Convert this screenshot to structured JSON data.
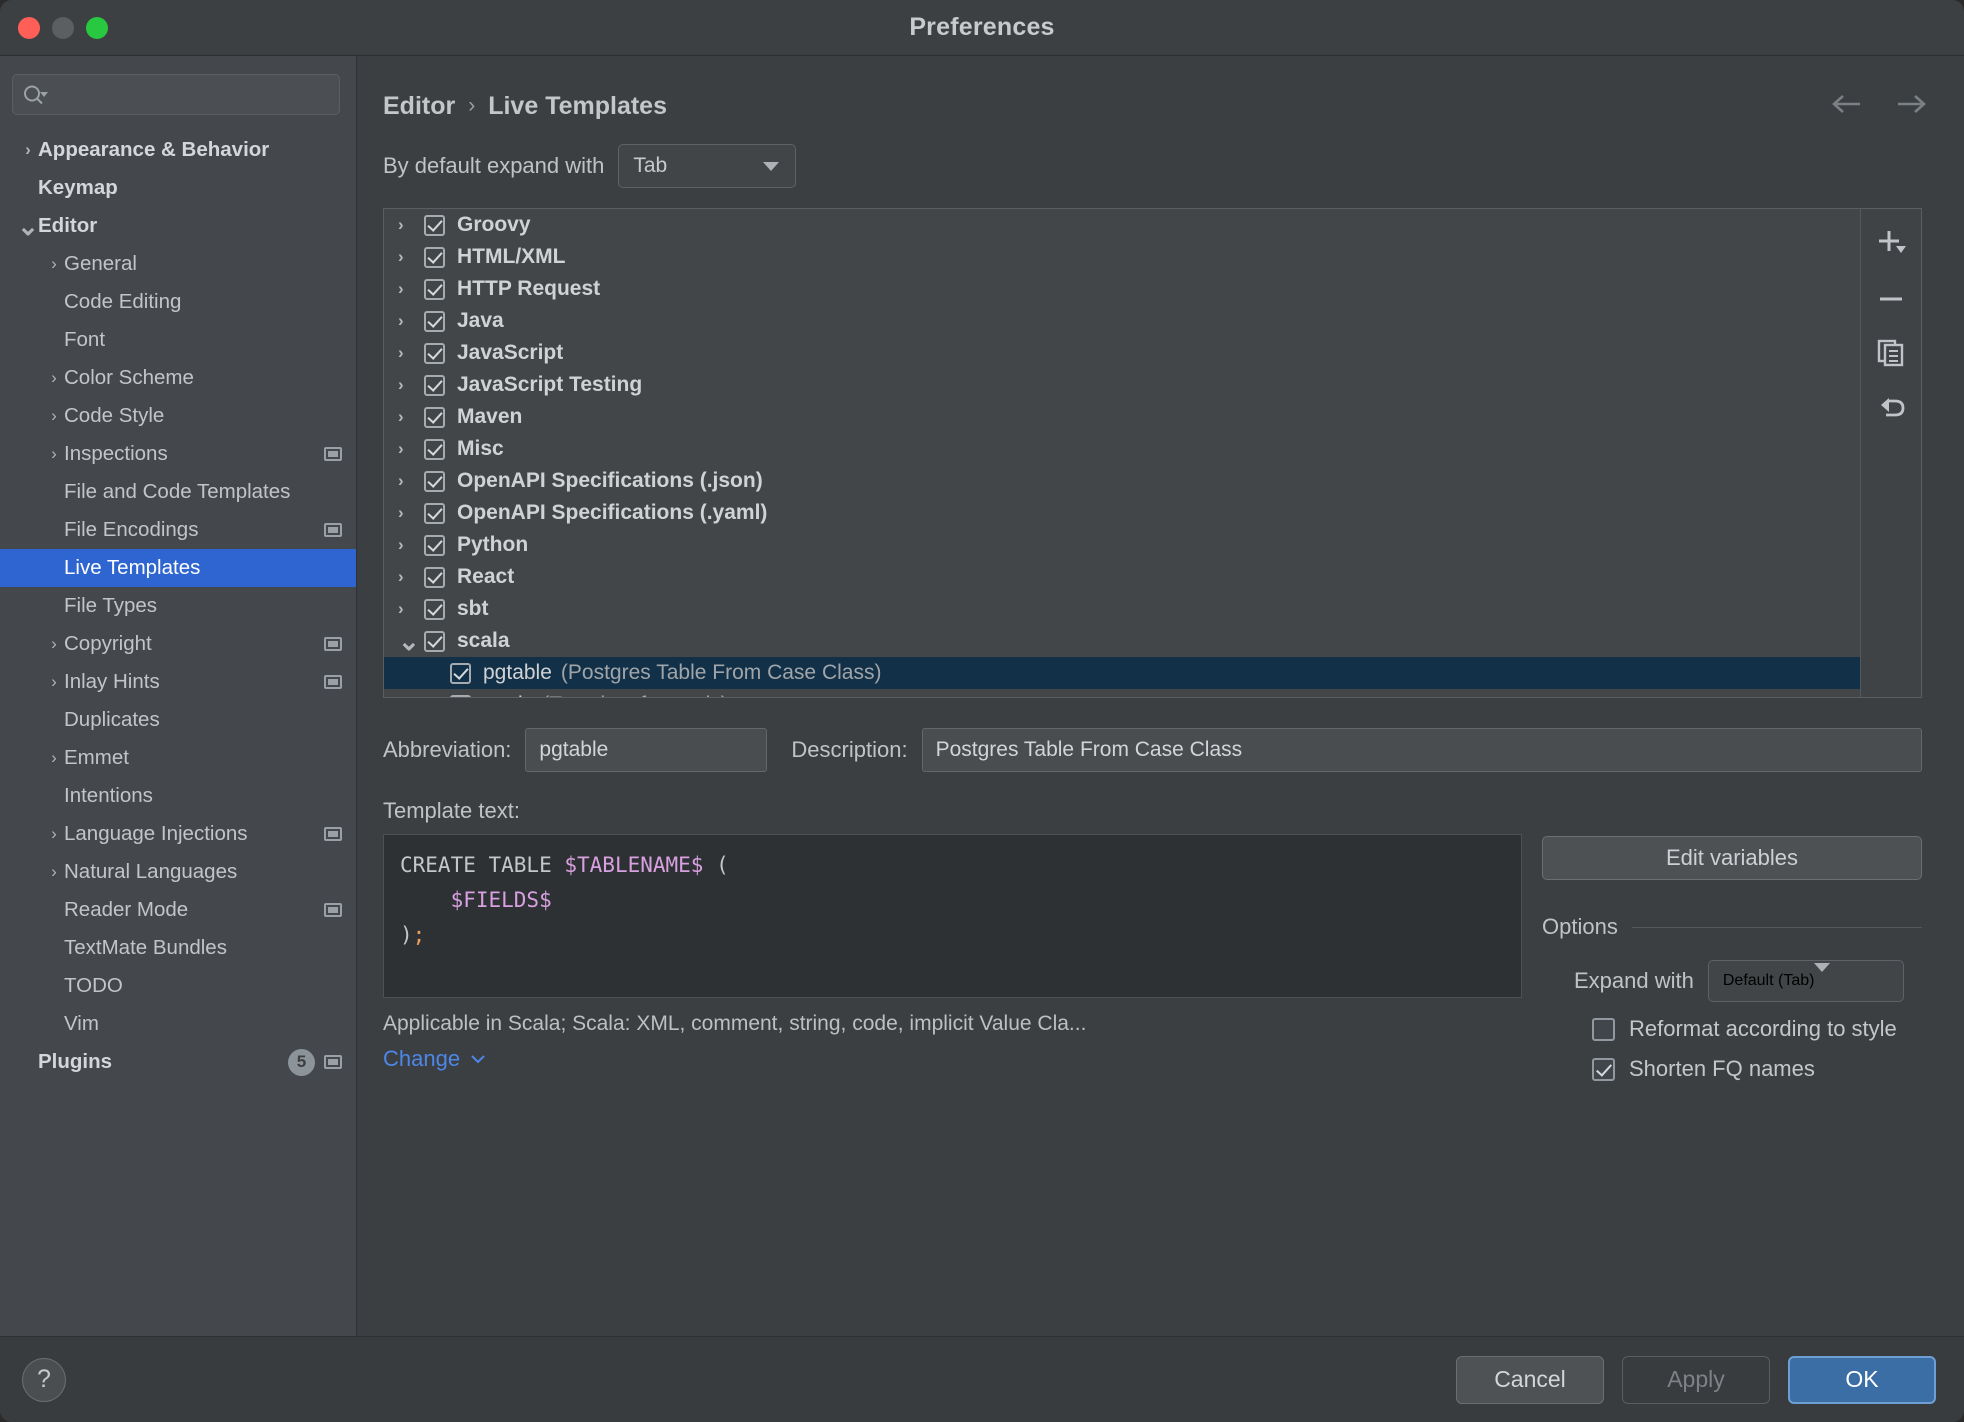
{
  "window": {
    "title": "Preferences"
  },
  "traffic_lights": {
    "close": "close",
    "minimize": "minimize",
    "zoom": "zoom"
  },
  "search": {
    "placeholder": "",
    "value": "",
    "icon": "search-icon"
  },
  "sidebar": {
    "items": [
      {
        "label": "Appearance & Behavior",
        "level": 0,
        "arrow": "right",
        "bold": true,
        "badge": null,
        "modified": false,
        "selected": false
      },
      {
        "label": "Keymap",
        "level": 0,
        "arrow": "none",
        "bold": true,
        "badge": null,
        "modified": false,
        "selected": false
      },
      {
        "label": "Editor",
        "level": 0,
        "arrow": "down",
        "bold": true,
        "badge": null,
        "modified": false,
        "selected": false
      },
      {
        "label": "General",
        "level": 1,
        "arrow": "right",
        "bold": false,
        "badge": null,
        "modified": false,
        "selected": false
      },
      {
        "label": "Code Editing",
        "level": 1,
        "arrow": "none",
        "bold": false,
        "badge": null,
        "modified": false,
        "selected": false
      },
      {
        "label": "Font",
        "level": 1,
        "arrow": "none",
        "bold": false,
        "badge": null,
        "modified": false,
        "selected": false
      },
      {
        "label": "Color Scheme",
        "level": 1,
        "arrow": "right",
        "bold": false,
        "badge": null,
        "modified": false,
        "selected": false
      },
      {
        "label": "Code Style",
        "level": 1,
        "arrow": "right",
        "bold": false,
        "badge": null,
        "modified": false,
        "selected": false
      },
      {
        "label": "Inspections",
        "level": 1,
        "arrow": "right",
        "bold": false,
        "badge": null,
        "modified": true,
        "selected": false
      },
      {
        "label": "File and Code Templates",
        "level": 1,
        "arrow": "none",
        "bold": false,
        "badge": null,
        "modified": false,
        "selected": false
      },
      {
        "label": "File Encodings",
        "level": 1,
        "arrow": "none",
        "bold": false,
        "badge": null,
        "modified": true,
        "selected": false
      },
      {
        "label": "Live Templates",
        "level": 1,
        "arrow": "none",
        "bold": false,
        "badge": null,
        "modified": false,
        "selected": true
      },
      {
        "label": "File Types",
        "level": 1,
        "arrow": "none",
        "bold": false,
        "badge": null,
        "modified": false,
        "selected": false
      },
      {
        "label": "Copyright",
        "level": 1,
        "arrow": "right",
        "bold": false,
        "badge": null,
        "modified": true,
        "selected": false
      },
      {
        "label": "Inlay Hints",
        "level": 1,
        "arrow": "right",
        "bold": false,
        "badge": null,
        "modified": true,
        "selected": false
      },
      {
        "label": "Duplicates",
        "level": 1,
        "arrow": "none",
        "bold": false,
        "badge": null,
        "modified": false,
        "selected": false
      },
      {
        "label": "Emmet",
        "level": 1,
        "arrow": "right",
        "bold": false,
        "badge": null,
        "modified": false,
        "selected": false
      },
      {
        "label": "Intentions",
        "level": 1,
        "arrow": "none",
        "bold": false,
        "badge": null,
        "modified": false,
        "selected": false
      },
      {
        "label": "Language Injections",
        "level": 1,
        "arrow": "right",
        "bold": false,
        "badge": null,
        "modified": true,
        "selected": false
      },
      {
        "label": "Natural Languages",
        "level": 1,
        "arrow": "right",
        "bold": false,
        "badge": null,
        "modified": false,
        "selected": false
      },
      {
        "label": "Reader Mode",
        "level": 1,
        "arrow": "none",
        "bold": false,
        "badge": null,
        "modified": true,
        "selected": false
      },
      {
        "label": "TextMate Bundles",
        "level": 1,
        "arrow": "none",
        "bold": false,
        "badge": null,
        "modified": false,
        "selected": false
      },
      {
        "label": "TODO",
        "level": 1,
        "arrow": "none",
        "bold": false,
        "badge": null,
        "modified": false,
        "selected": false
      },
      {
        "label": "Vim",
        "level": 1,
        "arrow": "none",
        "bold": false,
        "badge": null,
        "modified": false,
        "selected": false
      },
      {
        "label": "Plugins",
        "level": 0,
        "arrow": "none",
        "bold": true,
        "badge": "5",
        "modified": true,
        "selected": false
      }
    ]
  },
  "breadcrumb": {
    "parent": "Editor",
    "separator": "›",
    "current": "Live Templates"
  },
  "nav": {
    "back": "back-arrow",
    "forward": "forward-arrow"
  },
  "expand_with": {
    "label": "By default expand with",
    "value": "Tab"
  },
  "template_tree": {
    "rows": [
      {
        "label": "Groovy",
        "desc": "",
        "level": 0,
        "arrow": "right",
        "checked": true,
        "selected": false
      },
      {
        "label": "HTML/XML",
        "desc": "",
        "level": 0,
        "arrow": "right",
        "checked": true,
        "selected": false
      },
      {
        "label": "HTTP Request",
        "desc": "",
        "level": 0,
        "arrow": "right",
        "checked": true,
        "selected": false
      },
      {
        "label": "Java",
        "desc": "",
        "level": 0,
        "arrow": "right",
        "checked": true,
        "selected": false
      },
      {
        "label": "JavaScript",
        "desc": "",
        "level": 0,
        "arrow": "right",
        "checked": true,
        "selected": false
      },
      {
        "label": "JavaScript Testing",
        "desc": "",
        "level": 0,
        "arrow": "right",
        "checked": true,
        "selected": false
      },
      {
        "label": "Maven",
        "desc": "",
        "level": 0,
        "arrow": "right",
        "checked": true,
        "selected": false
      },
      {
        "label": "Misc",
        "desc": "",
        "level": 0,
        "arrow": "right",
        "checked": true,
        "selected": false
      },
      {
        "label": "OpenAPI Specifications (.json)",
        "desc": "",
        "level": 0,
        "arrow": "right",
        "checked": true,
        "selected": false
      },
      {
        "label": "OpenAPI Specifications (.yaml)",
        "desc": "",
        "level": 0,
        "arrow": "right",
        "checked": true,
        "selected": false
      },
      {
        "label": "Python",
        "desc": "",
        "level": 0,
        "arrow": "right",
        "checked": true,
        "selected": false
      },
      {
        "label": "React",
        "desc": "",
        "level": 0,
        "arrow": "right",
        "checked": true,
        "selected": false
      },
      {
        "label": "sbt",
        "desc": "",
        "level": 0,
        "arrow": "right",
        "checked": true,
        "selected": false
      },
      {
        "label": "scala",
        "desc": "",
        "level": 0,
        "arrow": "down",
        "checked": true,
        "selected": false
      },
      {
        "label": "pgtable",
        "desc": "(Postgres Table From Case Class)",
        "level": 1,
        "arrow": "none",
        "checked": true,
        "selected": true
      },
      {
        "label": "apply",
        "desc": "(Template for apply)",
        "level": 1,
        "arrow": "none",
        "checked": true,
        "selected": false
      }
    ]
  },
  "list_toolbar": {
    "add": "plus-icon",
    "remove": "minus-icon",
    "duplicate": "copy-icon",
    "revert": "undo-icon"
  },
  "detail": {
    "abbreviation_label": "Abbreviation:",
    "abbreviation_value": "pgtable",
    "description_label": "Description:",
    "description_value": "Postgres Table From Case Class",
    "template_text_label": "Template text:",
    "code": {
      "line1_pre": "CREATE TABLE ",
      "line1_var": "$TABLENAME$",
      "line1_post": " (",
      "line2_var": "    $FIELDS$",
      "line3_pre": ")",
      "line3_punct": ";"
    },
    "applicable_text": "Applicable in Scala; Scala: XML, comment, string, code, implicit Value Cla...",
    "change_link": "Change",
    "edit_variables_button": "Edit variables"
  },
  "options": {
    "title": "Options",
    "expand_with_label": "Expand with",
    "expand_with_value": "Default (Tab)",
    "reformat_label": "Reformat according to style",
    "reformat_checked": false,
    "shorten_label": "Shorten FQ names",
    "shorten_checked": true
  },
  "footer": {
    "help": "?",
    "cancel": "Cancel",
    "apply": "Apply",
    "ok": "OK"
  },
  "colors": {
    "accent_selection": "#2f65d0",
    "list_selection": "#123047",
    "link": "#4d86e8",
    "ok_button": "#3a6ea5",
    "variable": "#d8a0e0",
    "punctuation": "#e8a05a"
  }
}
